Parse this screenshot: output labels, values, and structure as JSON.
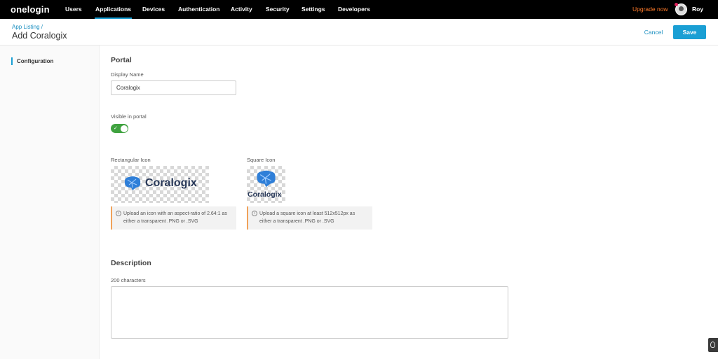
{
  "nav": {
    "logo": "onelogin",
    "items": [
      "Users",
      "Applications",
      "Devices",
      "Authentication",
      "Activity",
      "Security",
      "Settings",
      "Developers"
    ],
    "active": "Applications",
    "upgrade": "Upgrade now",
    "user": "Roy"
  },
  "header": {
    "breadcrumb": "App Listing /",
    "title": "Add Coralogix",
    "cancel": "Cancel",
    "save": "Save"
  },
  "sidebar": {
    "items": [
      "Configuration"
    ]
  },
  "portal": {
    "title": "Portal",
    "display_name_label": "Display Name",
    "display_name_value": "Coralogix",
    "visible_label": "Visible in portal",
    "visible": true,
    "rect_icon_label": "Rectangular Icon",
    "square_icon_label": "Square Icon",
    "brand": "Coralogix",
    "rect_info": "Upload an icon with an aspect-ratio of 2.64:1 as either a transparent .PNG or .SVG",
    "square_info": "Upload a square icon at least 512x512px as either a transparent .PNG or .SVG"
  },
  "description": {
    "title": "Description",
    "label": "200 characters",
    "value": ""
  },
  "colors": {
    "accent": "#1a9fd4",
    "upgrade": "#ff7a29",
    "toggle": "#3fa23f",
    "info_border": "#f0a25a"
  }
}
